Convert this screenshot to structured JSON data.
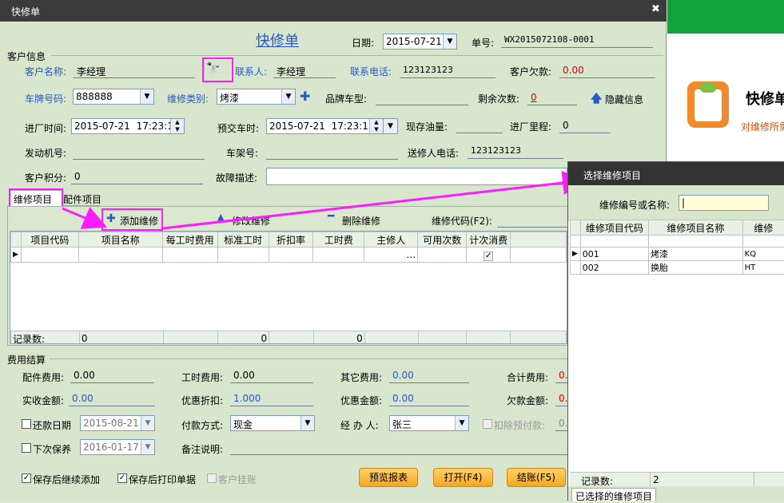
{
  "window": {
    "title": "快修单",
    "close": "✖"
  },
  "form": {
    "heading": "快修单",
    "date_label": "日期:",
    "date_value": "2015-07-21",
    "order_label": "单号:",
    "order_value": "WX2015072108-0001",
    "customer_info_section": "客户信息",
    "customer_name_label": "客户名称:",
    "customer_name": "李经理",
    "contact_label": "联系人:",
    "contact": "李经理",
    "phone_label": "联系电话:",
    "phone": "123123123",
    "debt_label": "客户欠款:",
    "debt": "0.00",
    "plate_label": "车牌号码:",
    "plate": "888888",
    "repair_type_label": "维修类别:",
    "repair_type": "烤漆",
    "brand_label": "品牌车型:",
    "remain_label": "剩余次数:",
    "remain": "0",
    "hide_info": "隐藏信息",
    "in_time_label": "进厂时间:",
    "in_date": "2015-07-21",
    "in_time": "17:23:15",
    "deliver_label": "预交车时:",
    "deliver_date": "2015-07-21",
    "deliver_time": "17:23:15",
    "oil_label": "现存油量:",
    "mileage_label": "进厂里程:",
    "mileage": "0",
    "engine_label": "发动机号:",
    "frame_label": "车架号:",
    "sender_phone_label": "送修人电话:",
    "sender_phone": "123123123",
    "points_label": "客户积分:",
    "points": "0",
    "fault_label": "故障描述:"
  },
  "tabs": {
    "repair": "维修项目",
    "parts": "配件项目"
  },
  "toolbar": {
    "add": "添加维修",
    "edit": "修改维修",
    "delete": "删除维修",
    "code_label": "维修代码(F2):"
  },
  "grid": {
    "headers": [
      "项目代码",
      "项目名称",
      "每工时费用",
      "标准工时",
      "折扣率",
      "工时费",
      "主修人",
      "可用次数",
      "计次消费"
    ],
    "footer_label": "记录数:",
    "footer_count": "0",
    "footer_hours": "0",
    "footer_fee": "0",
    "ellipsis": "…"
  },
  "fees": {
    "section": "费用结算",
    "parts_fee_label": "配件费用:",
    "parts_fee": "0.00",
    "labor_fee_label": "工时费用:",
    "labor_fee": "0.00",
    "other_fee_label": "其它费用:",
    "other_fee": "0.00",
    "total_label": "合计费用:",
    "total": "0.",
    "received_label": "实收金额:",
    "received": "0.00",
    "discount_label": "优惠折扣:",
    "discount": "1.000",
    "discount_amount_label": "优惠金额:",
    "discount_amount": "0.00",
    "owe_label": "欠款金额:",
    "owe": "0.",
    "repay_date_label": "还款日期",
    "repay_date": "2015-08-21",
    "pay_method_label": "付款方式:",
    "pay_method": "现金",
    "handler_label": "经 办 人:",
    "handler": "张三",
    "deduct_label": "扣除预付款:",
    "deduct": "0.",
    "next_maint_label": "下次保养",
    "next_maint": "2016-01-17",
    "remark_label": "备注说明:"
  },
  "footer": {
    "save_continue": "保存后继续添加",
    "save_print": "保存后打印单据",
    "hang": "客户挂账",
    "preview": "预览报表",
    "open": "打开(F4)",
    "settle": "结账(F5)"
  },
  "side": {
    "title": "快修单",
    "subtitle": "对维修所需"
  },
  "popup": {
    "title": "选择维修项目",
    "search_label": "维修编号或名称:",
    "headers": [
      "维修项目代码",
      "维修项目名称",
      "维修"
    ],
    "rows": [
      {
        "code": "001",
        "name": "烤漆",
        "abbr": "KQ"
      },
      {
        "code": "002",
        "name": "换胎",
        "abbr": "HT"
      }
    ],
    "footer_label": "记录数:",
    "footer_count": "2",
    "selected_tab": "已选择的维修项目"
  },
  "colors": {
    "highlight": "#ff1bff",
    "label_blue": "#2a58c9",
    "accent_green": "#10a53a"
  }
}
